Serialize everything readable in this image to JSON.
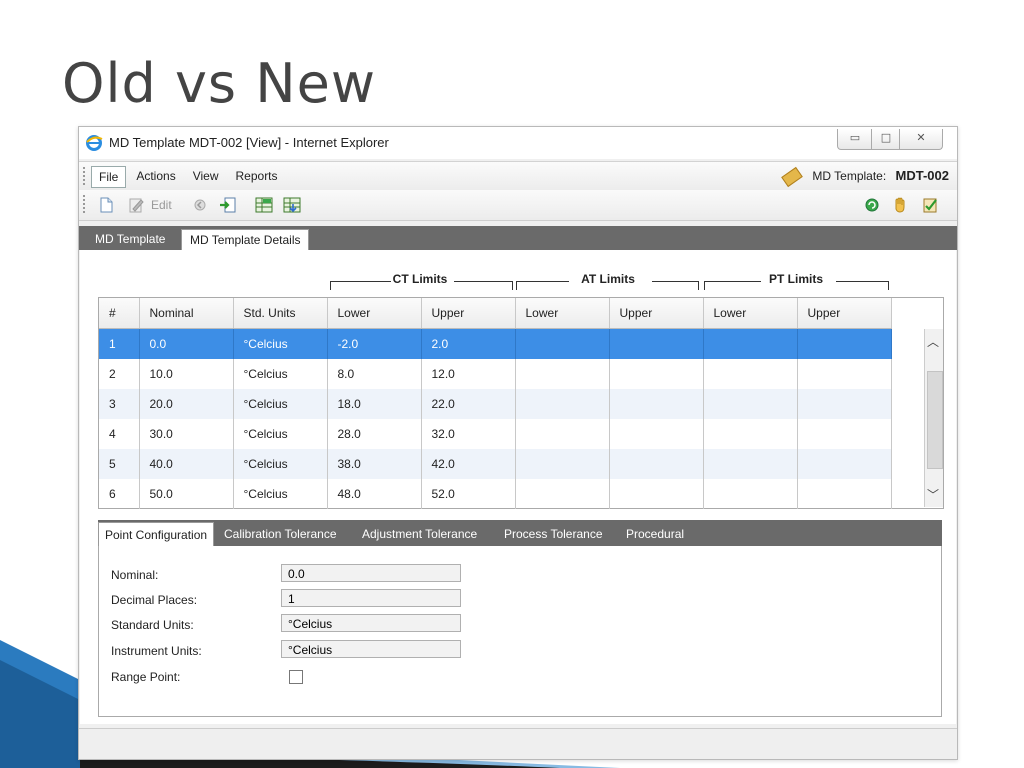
{
  "slide": {
    "title": "Old vs New"
  },
  "window": {
    "title": "MD Template MDT-002 [View] - Internet Explorer",
    "controls": {
      "minimize": "▭",
      "maximize": "□",
      "close": "✕"
    }
  },
  "menubar": {
    "items": [
      "File",
      "Actions",
      "View",
      "Reports"
    ],
    "template_label": "MD Template:",
    "template_id": "MDT-002"
  },
  "toolbar": {
    "edit_label": "Edit"
  },
  "tabs": [
    "MD Template",
    "MD Template Details"
  ],
  "grid": {
    "groups": [
      "CT Limits",
      "AT Limits",
      "PT Limits"
    ],
    "columns": [
      "#",
      "Nominal",
      "Std. Units",
      "Lower",
      "Upper",
      "Lower",
      "Upper",
      "Lower",
      "Upper"
    ],
    "rows": [
      [
        "1",
        "0.0",
        "°Celcius",
        "-2.0",
        "2.0",
        "",
        "",
        "",
        ""
      ],
      [
        "2",
        "10.0",
        "°Celcius",
        "8.0",
        "12.0",
        "",
        "",
        "",
        ""
      ],
      [
        "3",
        "20.0",
        "°Celcius",
        "18.0",
        "22.0",
        "",
        "",
        "",
        ""
      ],
      [
        "4",
        "30.0",
        "°Celcius",
        "28.0",
        "32.0",
        "",
        "",
        "",
        ""
      ],
      [
        "5",
        "40.0",
        "°Celcius",
        "38.0",
        "42.0",
        "",
        "",
        "",
        ""
      ],
      [
        "6",
        "50.0",
        "°Celcius",
        "48.0",
        "52.0",
        "",
        "",
        "",
        ""
      ]
    ],
    "scroll": {
      "up": "︿",
      "down": "﹀"
    }
  },
  "detail_tabs": [
    "Point Configuration",
    "Calibration Tolerance",
    "Adjustment Tolerance",
    "Process Tolerance",
    "Procedural"
  ],
  "point_config": {
    "nominal_label": "Nominal:",
    "nominal_value": "0.0",
    "decimal_label": "Decimal Places:",
    "decimal_value": "1",
    "std_units_label": "Standard Units:",
    "std_units_value": "°Celcius",
    "inst_units_label": "Instrument Units:",
    "inst_units_value": "°Celcius",
    "range_point_label": "Range Point:",
    "range_point_checked": false
  },
  "icons": {
    "browser": "ie-icon",
    "template": "ruler-icon",
    "toolbar": [
      "new-document-icon",
      "edit-icon",
      "back-icon",
      "export-icon",
      "grid-add-icon",
      "grid-export-icon"
    ],
    "toolbar_right": [
      "refresh-icon",
      "hand-icon",
      "approve-icon"
    ]
  }
}
